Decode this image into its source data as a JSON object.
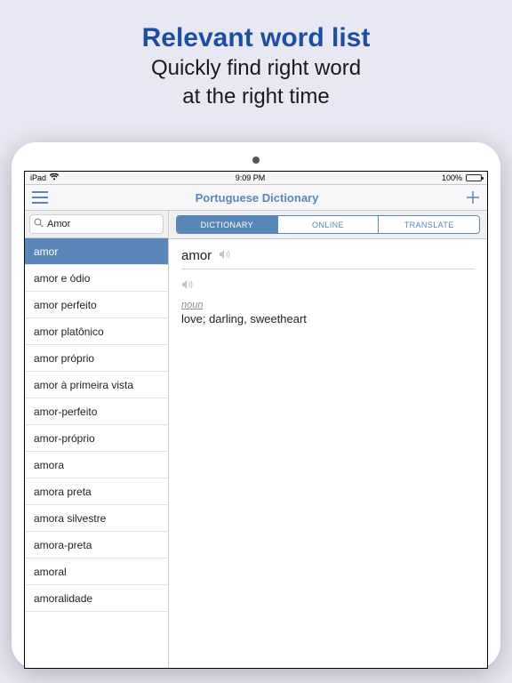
{
  "promo": {
    "title": "Relevant word list",
    "sub1": "Quickly find right word",
    "sub2": "at the right time"
  },
  "statusbar": {
    "carrier": "iPad",
    "time": "9:09 PM",
    "battery": "100%"
  },
  "navbar": {
    "title": "Portuguese Dictionary"
  },
  "search": {
    "value": "Amor"
  },
  "segmented": {
    "dictionary": "DICTIONARY",
    "online": "ONLINE",
    "translate": "TRANSLATE"
  },
  "words": [
    "amor",
    "amor e ódio",
    "amor perfeito",
    "amor platônico",
    "amor próprio",
    "amor à primeira vista",
    "amor-perfeito",
    "amor-próprio",
    "amora",
    "amora preta",
    "amora silvestre",
    "amora-preta",
    "amoral",
    "amoralidade"
  ],
  "definition": {
    "headword": "amor",
    "pos": "noun",
    "body": "love; darling, sweetheart"
  }
}
